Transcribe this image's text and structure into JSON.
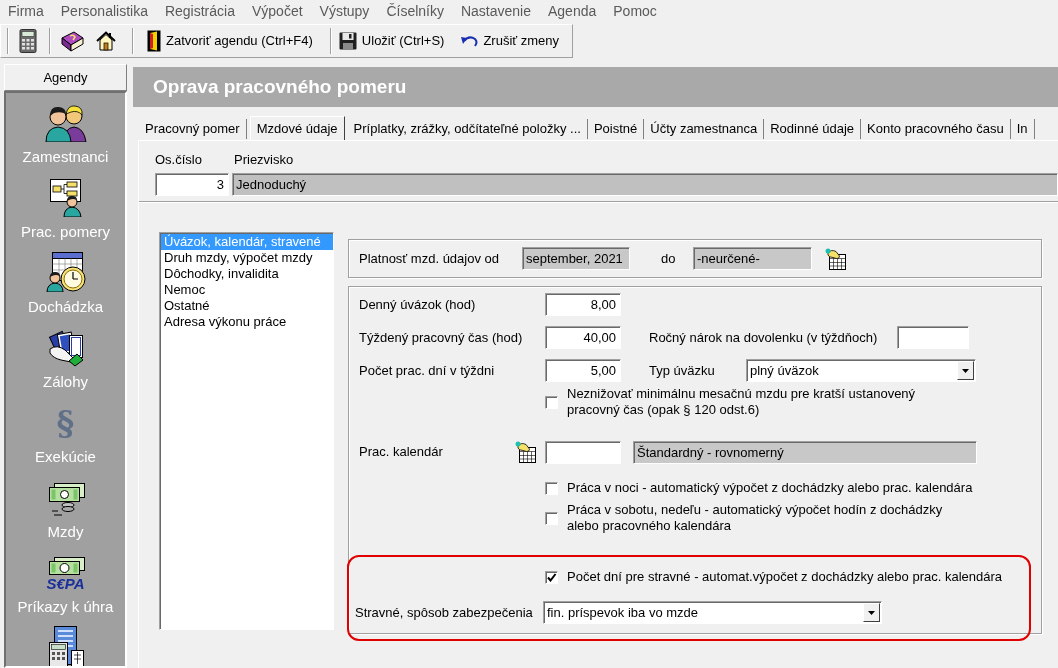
{
  "menu_bar": {
    "items": [
      "Firma",
      "Personalistika",
      "Registrácia",
      "Výpočet",
      "Výstupy",
      "Číselníky",
      "Nastavenie",
      "Agenda",
      "Pomoc"
    ]
  },
  "toolbar": {
    "buttons": [
      {
        "label": "Zatvoriť agendu (Ctrl+F4)"
      },
      {
        "label": "Uložiť (Ctrl+S)"
      },
      {
        "label": "Zrušiť zmeny"
      }
    ]
  },
  "sidebar": {
    "header": "Agendy",
    "items": [
      {
        "label": "Zamestnanci"
      },
      {
        "label": "Prac. pomery"
      },
      {
        "label": "Dochádzka"
      },
      {
        "label": "Zálohy"
      },
      {
        "label": "Exekúcie",
        "glyph": "§"
      },
      {
        "label": "Mzdy"
      },
      {
        "label": "Príkazy k úhra",
        "logo_text": "S€PA"
      }
    ]
  },
  "page_title": "Oprava pracovného pomeru",
  "tabs": [
    {
      "label": "Pracovný pomer",
      "selected": false
    },
    {
      "label": "Mzdové údaje",
      "selected": true
    },
    {
      "label": "Príplatky, zrážky, odčítateľné položky ...",
      "selected": false
    },
    {
      "label": "Poistné",
      "selected": false
    },
    {
      "label": "Účty zamestnanca",
      "selected": false
    },
    {
      "label": "Rodinné údaje",
      "selected": false
    },
    {
      "label": "Konto pracovného času",
      "selected": false
    },
    {
      "label": "In",
      "selected": false
    }
  ],
  "employee": {
    "number_label": "Os.číslo",
    "number": "3",
    "surname_label": "Priezvisko",
    "surname": "Jednoduchý"
  },
  "section_list": {
    "items": [
      {
        "label": "Úvázok, kalendár, stravené",
        "selected": true
      },
      {
        "label": "Druh mzdy, výpočet mzdy",
        "selected": false
      },
      {
        "label": "Dôchodky, invalidita",
        "selected": false
      },
      {
        "label": "Nemoc",
        "selected": false
      },
      {
        "label": "Ostatné",
        "selected": false
      },
      {
        "label": "Adresa výkonu práce",
        "selected": false
      }
    ]
  },
  "validity": {
    "from_label": "Platnosť mzd. údajov od",
    "from": "september, 2021",
    "to_label": "do",
    "to": "-neurčené-"
  },
  "work_time": {
    "daily_hours": {
      "label": "Denný úvázok (hod)",
      "value": "8,00"
    },
    "weekly_hours": {
      "label": "Týždený pracovný čas (hod)",
      "value": "40,00"
    },
    "annual_leave": {
      "label": "Ročný nárok na dovolenku (v týždňoch)"
    },
    "days_per_week": {
      "label": "Počet prac. dní v týždni",
      "value": "5,00"
    },
    "contract_type": {
      "label": "Typ úväzku",
      "value": "plný úväzok"
    },
    "min_wage": {
      "label": "Neznižovať minimálnu mesačnú mzdu pre kratší ustanovený pracovný čas (opak § 120 odst.6)",
      "checked": false
    }
  },
  "calendar": {
    "label": "Prac. kalendár",
    "name": "Štandardný - rovnomerný",
    "checkboxes": [
      {
        "label": "Práca v noci - automatický výpočet z dochádzky alebo prac. kalendára",
        "checked": false
      },
      {
        "label": "Práca v sobotu, nedeľu - automatický výpočet hodín z dochádzky alebo pracovného kalendára",
        "checked": false
      }
    ]
  },
  "meal_allowance": {
    "checkbox": {
      "label": "Počet dní pre stravné - automat.výpočet z dochádzky alebo prac. kalendára",
      "checked": true
    },
    "provision_label": "Stravné, spôsob zabezpečenia",
    "provision": "fin. príspevok iba vo mzde"
  }
}
